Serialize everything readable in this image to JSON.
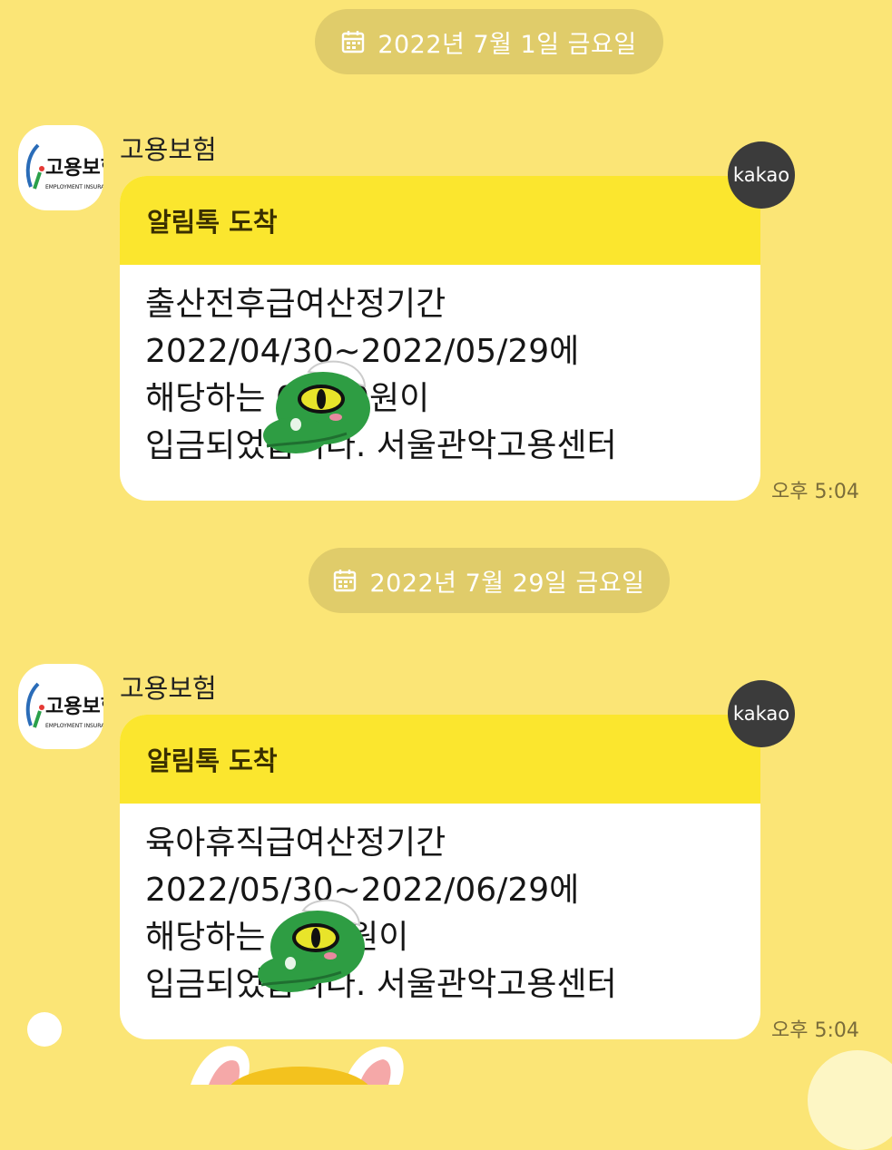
{
  "dates": [
    {
      "label": "2022년 7월 1일 금요일"
    },
    {
      "label": "2022년 7월 29일 금요일"
    }
  ],
  "messages": [
    {
      "sender": "고용보험",
      "badge": "kakao",
      "header": "알림톡 도착",
      "body": "출산전후급여산정기간\n2022/04/30~2022/05/29에\n해당하는 0,000원이\n입금되었습니다. 서울관악고용센터",
      "time": "오후 5:04"
    },
    {
      "sender": "고용보험",
      "badge": "kakao",
      "header": "알림톡 도착",
      "body": "육아휴직급여산정기간\n2022/05/30~2022/06/29에\n해당하는 ,000원이\n입금되었습니다. 서울관악고용센터",
      "time": "오후 5:04"
    }
  ],
  "avatar": {
    "logo_text": "고용보험",
    "logo_sub": "EMPLOYMENT INSURANCE",
    "icon": "employment-insurance-logo"
  },
  "colors": {
    "background": "#fbe576",
    "header": "#fbe62e",
    "bubble": "#ffffff",
    "date_pill": "#e0cc6a",
    "kakao_badge": "#3b3b3b"
  }
}
